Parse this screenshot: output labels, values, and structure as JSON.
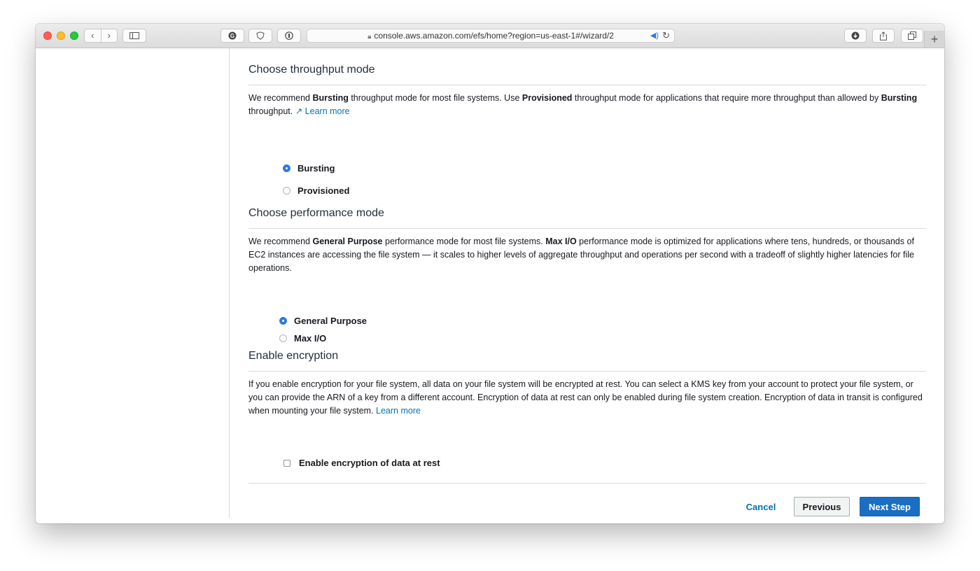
{
  "browser": {
    "url": "console.aws.amazon.com/efs/home?region=us-east-1#/wizard/2",
    "new_tab_symbol": "+"
  },
  "throughput": {
    "title": "Choose throughput mode",
    "desc_1": "We recommend ",
    "desc_bold_1": "Bursting",
    "desc_2": " throughput mode for most file systems. Use ",
    "desc_bold_2": "Provisioned",
    "desc_3": " throughput mode for applications that require more throughput than allowed by ",
    "desc_bold_3": "Bursting",
    "desc_4": " throughput. ",
    "learn_more": "Learn more",
    "options": [
      {
        "label": "Bursting",
        "selected": true
      },
      {
        "label": "Provisioned",
        "selected": false
      }
    ]
  },
  "performance": {
    "title": "Choose performance mode",
    "desc_1": "We recommend ",
    "desc_bold_1": "General Purpose",
    "desc_2": " performance mode for most file systems. ",
    "desc_bold_2": "Max I/O",
    "desc_3": " performance mode is optimized for applications where tens, hundreds, or thousands of EC2 instances are accessing the file system — it scales to higher levels of aggregate throughput and operations per second with a tradeoff of slightly higher latencies for file operations.",
    "options": [
      {
        "label": "General Purpose",
        "selected": true
      },
      {
        "label": "Max I/O",
        "selected": false
      }
    ]
  },
  "encryption": {
    "title": "Enable encryption",
    "desc": "If you enable encryption for your file system, all data on your file system will be encrypted at rest. You can select a KMS key from your account to protect your file system, or you can provide the ARN of a key from a different account. Encryption of data at rest can only be enabled during file system creation. Encryption of data in transit is configured when mounting your file system. ",
    "learn_more": "Learn more",
    "checkbox_label": "Enable encryption of data at rest",
    "checked": false
  },
  "footer": {
    "cancel": "Cancel",
    "previous": "Previous",
    "next": "Next Step"
  },
  "colors": {
    "link": "#0073bb",
    "primary_button": "#1a6fc4",
    "radio_selected": "#2f7be0"
  }
}
